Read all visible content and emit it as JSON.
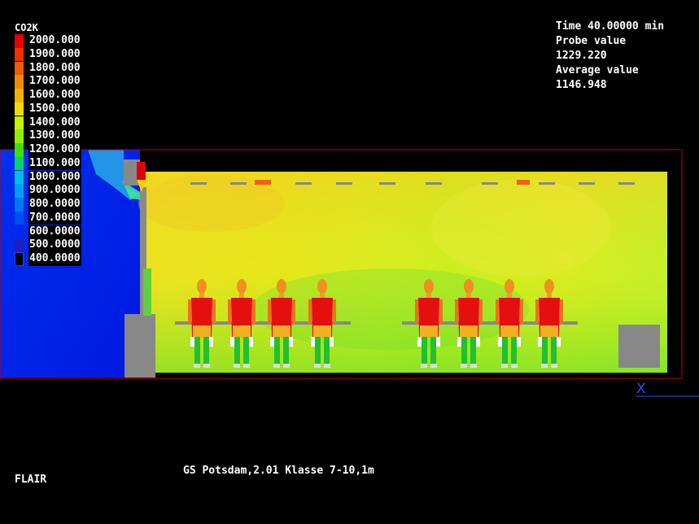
{
  "legend": {
    "title": "CO2K",
    "items": [
      {
        "label": "2000.000",
        "color": "#e60000"
      },
      {
        "label": "1900.000",
        "color": "#f03000"
      },
      {
        "label": "1800.000",
        "color": "#f05a00"
      },
      {
        "label": "1700.000",
        "color": "#f08a00"
      },
      {
        "label": "1600.000",
        "color": "#f0b400"
      },
      {
        "label": "1500.000",
        "color": "#f0dc00"
      },
      {
        "label": "1400.000",
        "color": "#c8f000"
      },
      {
        "label": "1300.000",
        "color": "#8cf000"
      },
      {
        "label": "1200.000",
        "color": "#3ce000"
      },
      {
        "label": "1100.000",
        "color": "#00d26e"
      },
      {
        "label": "1000.000",
        "color": "#00bede"
      },
      {
        "label": "900.0000",
        "color": "#00a0f0"
      },
      {
        "label": "800.0000",
        "color": "#0078f0"
      },
      {
        "label": "700.0000",
        "color": "#0050f0"
      },
      {
        "label": "600.0000",
        "color": "#0028f0"
      },
      {
        "label": "500.0000",
        "color": "#2020c0"
      },
      {
        "label": "400.0000",
        "color": "#1010a0"
      }
    ]
  },
  "info": {
    "time": "Time 40.00000 min",
    "probe_label": "Probe value",
    "probe_value": "1229.220",
    "average_label": "Average value",
    "average_value": "1146.948"
  },
  "caption": "GS Potsdam,2.01 Klasse 7-10,1m",
  "brand": "FLAIR",
  "axis_marker": "X"
}
